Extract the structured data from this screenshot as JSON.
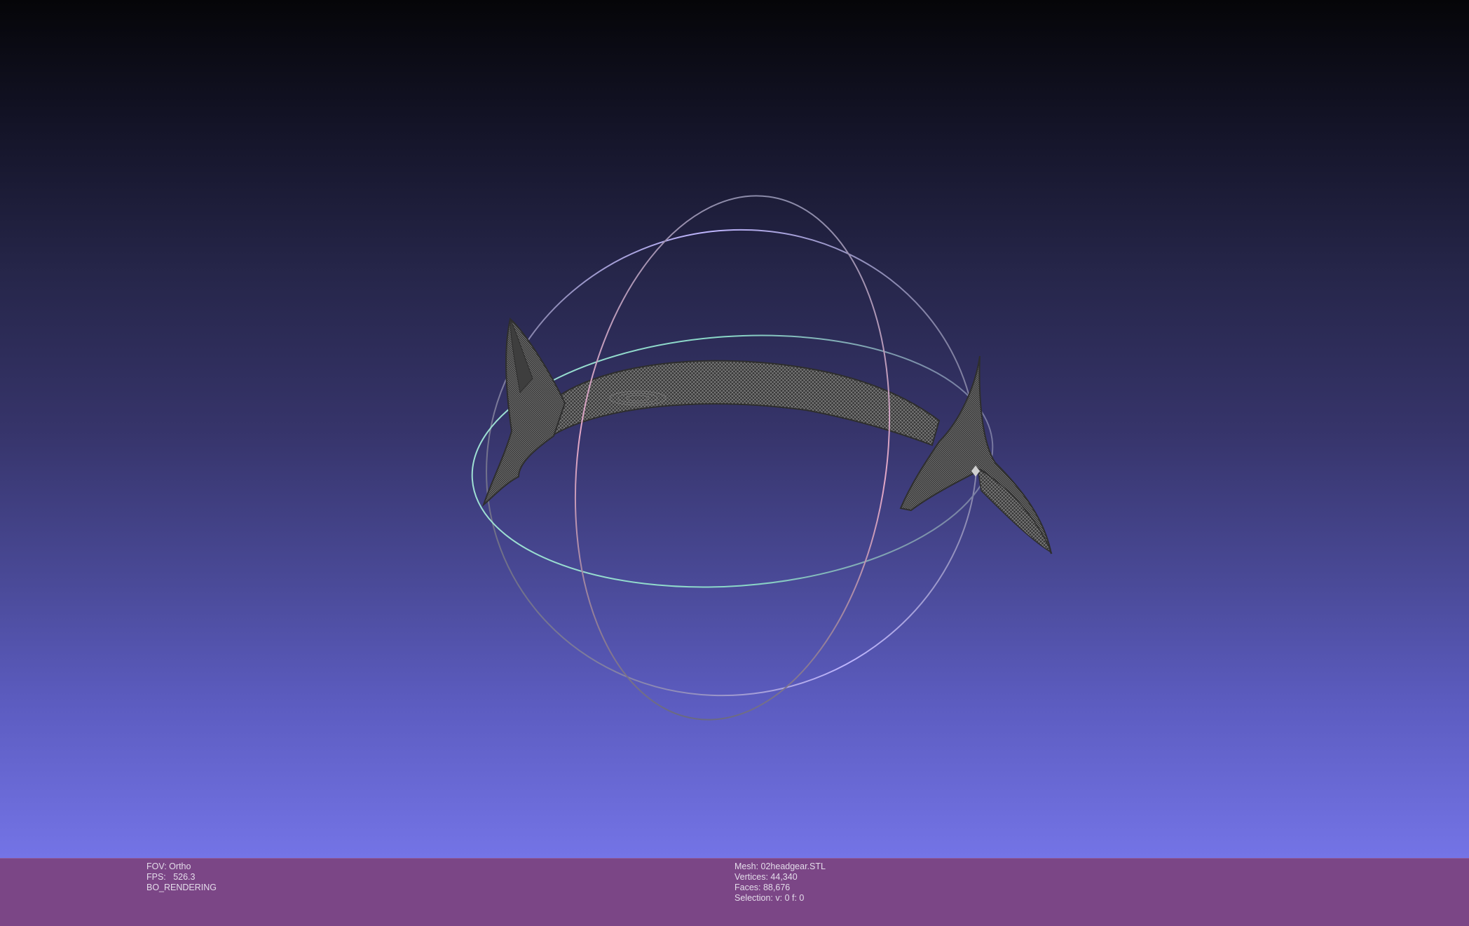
{
  "viewport": {
    "background_top": "#050508",
    "background_bottom": "#7474e6",
    "trackball": {
      "x_ring_color": "#e4a8c8",
      "y_ring_color": "#bfb6ff",
      "z_ring_color": "#9fe0d4"
    },
    "mesh_color": "#3a3a3a"
  },
  "info_left": {
    "fov": "FOV: Ortho",
    "fps": "FPS:   526.3",
    "render_mode": "BO_RENDERING"
  },
  "info_right": {
    "mesh": "Mesh: 02headgear.STL",
    "vertices": "Vertices: 44,340",
    "faces": "Faces: 88,676",
    "selection": "Selection: v: 0 f: 0"
  },
  "info_bar_color": "#7b4686"
}
